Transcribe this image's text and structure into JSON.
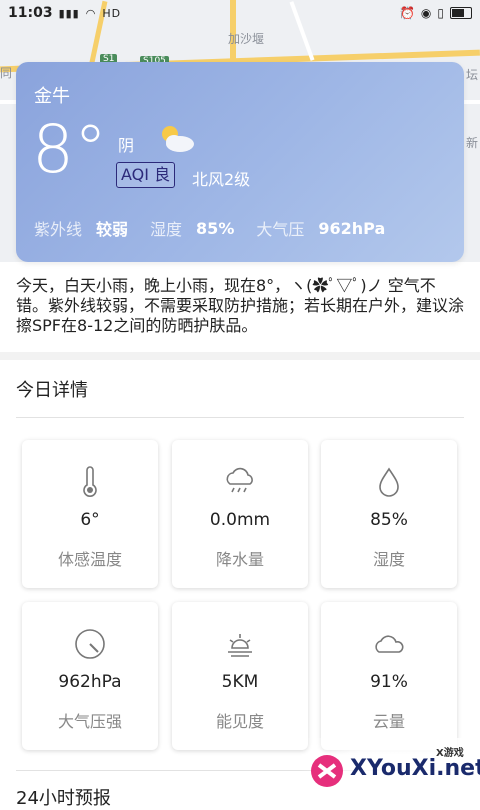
{
  "status_bar": {
    "time": "11:03",
    "signal": "HD"
  },
  "map": {
    "labels": [
      "加沙堰",
      "S1",
      "S105",
      "同",
      "新",
      "坛",
      "静"
    ],
    "colors": {
      "road": "#f6cf6a",
      "bg": "#eef0f3"
    }
  },
  "weather": {
    "city": "金牛",
    "temperature": "8°",
    "condition": "阴",
    "aqi_label": "AQI 良",
    "wind": "北风2级",
    "uv_label": "紫外线",
    "uv_value": "较弱",
    "humidity_label": "湿度",
    "humidity_value": "85%",
    "pressure_label": "大气压",
    "pressure_value": "962hPa",
    "icon": "partly-cloudy-icon"
  },
  "summary": "今天，白天小雨，晚上小雨，现在8°，ヽ(✿ﾟ▽ﾟ)ノ 空气不错。紫外线较弱，不需要采取防护措施；若长期在户外，建议涂擦SPF在8-12之间的防晒护肤品。",
  "today": {
    "title": "今日详情",
    "tiles": [
      {
        "value": "6°",
        "label": "体感温度",
        "icon": "thermometer-icon"
      },
      {
        "value": "0.0mm",
        "label": "降水量",
        "icon": "rain-cloud-icon"
      },
      {
        "value": "85%",
        "label": "湿度",
        "icon": "droplet-icon"
      },
      {
        "value": "962hPa",
        "label": "大气压强",
        "icon": "gauge-icon"
      },
      {
        "value": "5KM",
        "label": "能见度",
        "icon": "sunrise-icon"
      },
      {
        "value": "91%",
        "label": "云量",
        "icon": "cloud-icon"
      }
    ]
  },
  "next_section_title": "24小时预报",
  "watermark": {
    "small": "X游戏",
    "text": "XYouXi.net"
  }
}
